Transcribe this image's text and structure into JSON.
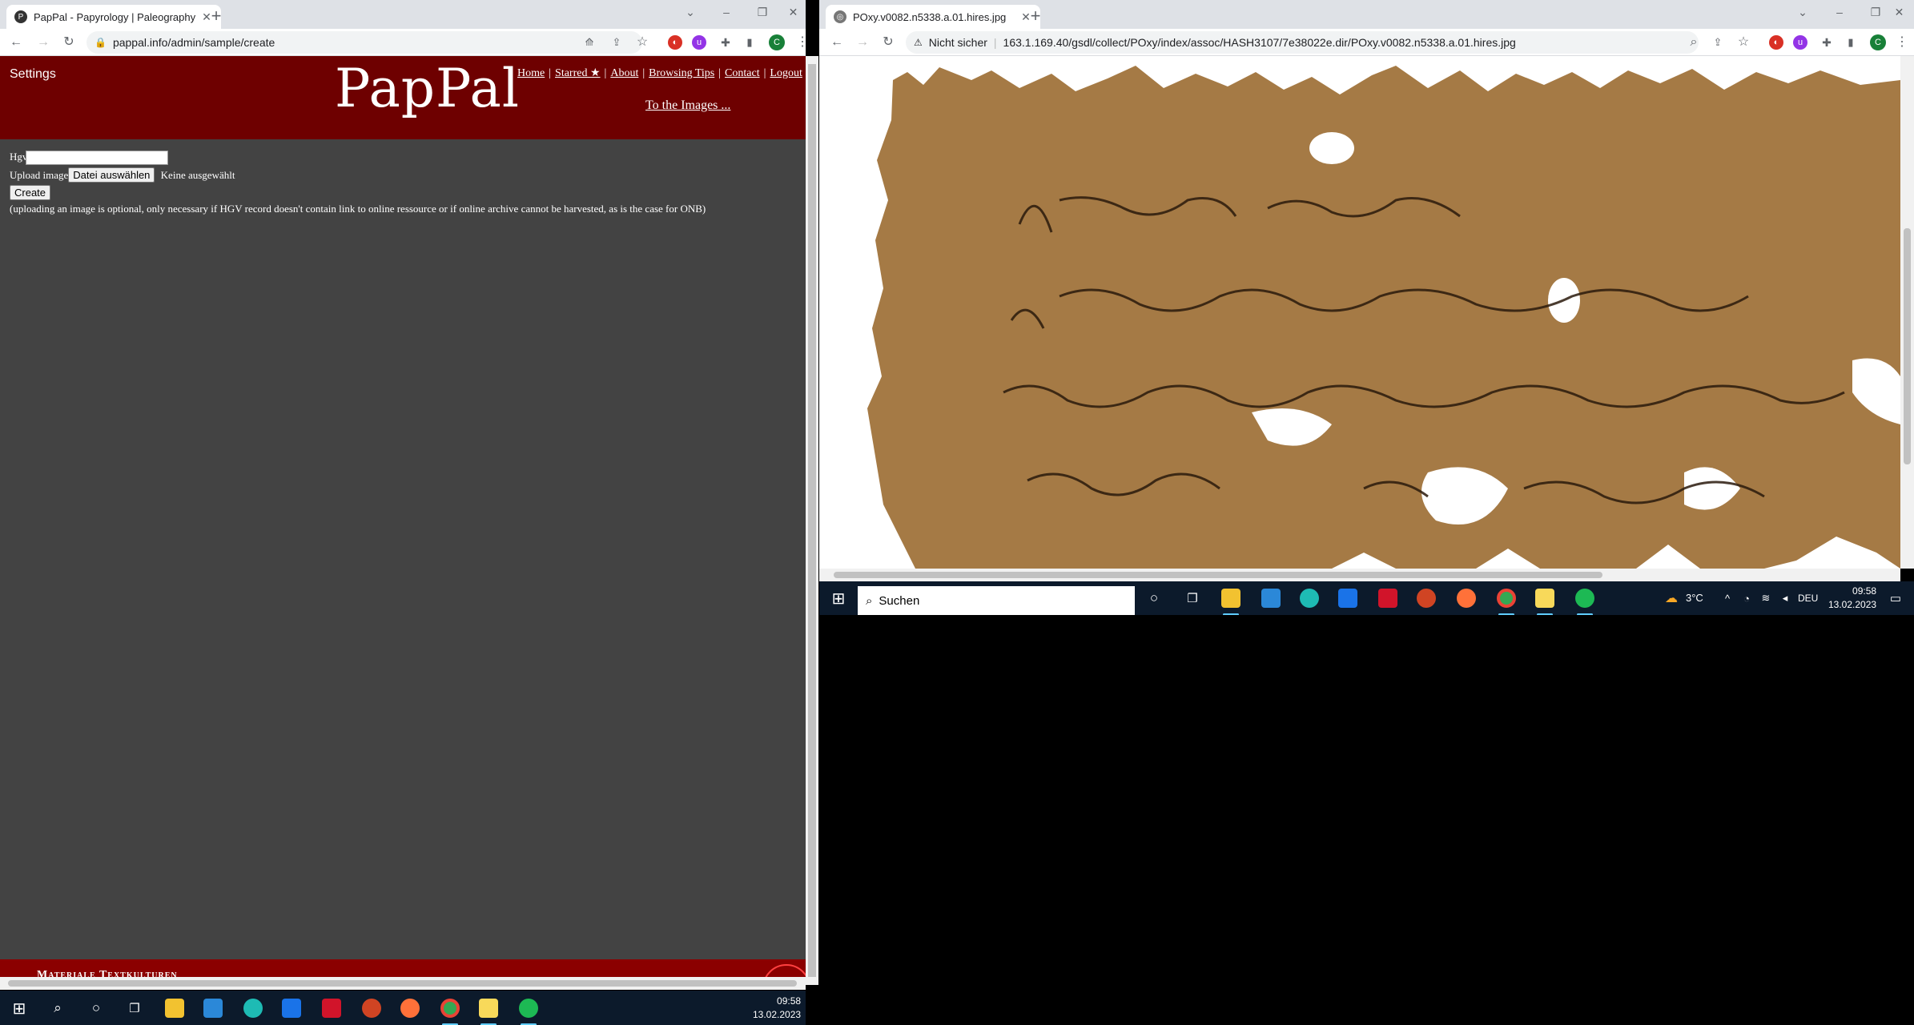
{
  "left_browser": {
    "tab_title": "PapPal - Papyrology | Paleography",
    "url": "pappal.info/admin/sample/create",
    "profile_initial": "C",
    "page": {
      "settings_label": "Settings",
      "logo_text": "PapPal",
      "nav": [
        "Home",
        "Starred ★",
        "About",
        "Browsing Tips",
        "Contact",
        "Logout"
      ],
      "to_images": "To the Images ...",
      "form": {
        "hgv_label": "Hgv",
        "hgv_value": "",
        "upload_label": "Upload image",
        "file_button": "Datei auswählen",
        "file_status": "Keine ausgewählt",
        "create_button": "Create",
        "note": "(uploading an image is optional, only necessary if HGV record doesn't contain link to online ressource or if online archive cannot be harvested, as is the case for ONB)"
      },
      "footer_text": "Materiale Textkulturen"
    },
    "taskbar": {
      "time": "09:58",
      "date": "13.02.2023"
    }
  },
  "right_browser": {
    "tab_title": "POxy.v0082.n5338.a.01.hires.jpg",
    "security_label": "Nicht sicher",
    "url": "163.1.169.40/gsdl/collect/POxy/index/assoc/HASH3107/7e38022e.dir/POxy.v0082.n5338.a.01.hires.jpg",
    "profile_initial": "C",
    "image_description_icon": "papyrus-image",
    "taskbar": {
      "search_placeholder": "Suchen",
      "weather": "3°C",
      "language": "DEU",
      "time": "09:58",
      "date": "13.02.2023"
    }
  },
  "colors": {
    "header_bg": "#6e0000",
    "page_bg": "#434343",
    "footer_bg": "#8b0000",
    "taskbar_bg": "#0c1a2b",
    "papyrus": "#a57a45"
  }
}
